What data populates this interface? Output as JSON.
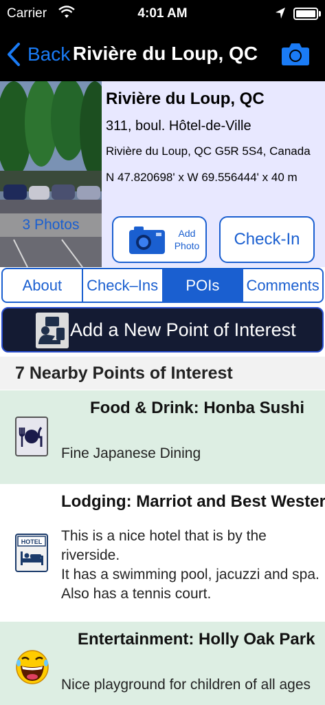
{
  "status_bar": {
    "carrier": "Carrier",
    "time": "4:01 AM"
  },
  "nav": {
    "back_label": "Back",
    "title": "Rivière du Loup, QC"
  },
  "location": {
    "name": "Rivière du Loup, QC",
    "street": "311, boul. Hôtel-de-Ville",
    "city": "Rivière du Loup, QC G5R 5S4, Canada",
    "coordinates": "N 47.820698' x W 69.556444' x 40 m",
    "photos_label": "3 Photos"
  },
  "actions": {
    "add_photo_line1": "Add",
    "add_photo_line2": "Photo",
    "check_in": "Check-In"
  },
  "tabs": [
    {
      "label": "About",
      "active": false
    },
    {
      "label": "Check–Ins",
      "active": false
    },
    {
      "label": "POIs",
      "active": true
    },
    {
      "label": "Comments",
      "active": false
    }
  ],
  "add_poi_label": "Add a New Point of Interest",
  "section_title": "7 Nearby Points of Interest",
  "pois": [
    {
      "title": "Food & Drink: Honba Sushi",
      "icon": "food-icon",
      "desc_lines": [
        "Fine Japanese Dining"
      ]
    },
    {
      "title": "Lodging: Marriot and Best Western",
      "icon": "hotel-icon",
      "desc_lines": [
        "This is a nice hotel that is by the",
        "riverside.",
        "It has a swimming pool, jacuzzi and spa.",
        "Also has a tennis court."
      ]
    },
    {
      "title": "Entertainment: Holly Oak Park",
      "icon": "laughing-face-icon",
      "desc_lines": [
        "Nice playground for children of all ages"
      ]
    }
  ],
  "icon_text": {
    "hotel_sign": "HOTEL"
  },
  "colors": {
    "accent": "#1a5fd0",
    "nav_back": "#1a7bf5",
    "row_alt": "#ddeee3"
  }
}
